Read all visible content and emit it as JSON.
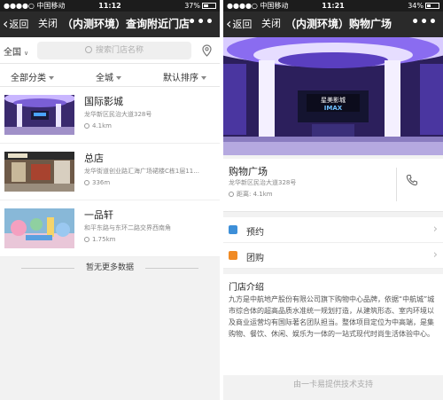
{
  "left": {
    "status": {
      "carrier": "●●●●○ 中国移动",
      "time": "11:12",
      "battery": "37%"
    },
    "nav": {
      "back": "返回",
      "close": "关闭",
      "title": "（内测环境）查询附近门店",
      "more": "•••"
    },
    "search": {
      "city": "全国",
      "placeholder": "搜索门店名称"
    },
    "filters": {
      "category": "全部分类",
      "area": "全城",
      "sort": "默认排序"
    },
    "stores": [
      {
        "name": "国际影城",
        "address": "龙华新区民治大道328号",
        "distance": "4.1km"
      },
      {
        "name": "总店",
        "address": "龙华街道创业路汇海广场裙楼C栋1层11...",
        "distance": "336m"
      },
      {
        "name": "一品轩",
        "address": "和平东路与东环二路交界西南角",
        "distance": "1.75km"
      }
    ],
    "no_more": "暂无更多数据"
  },
  "right": {
    "status": {
      "carrier": "●●●●○ 中国移动",
      "time": "11:21",
      "battery": "34%"
    },
    "nav": {
      "back": "返回",
      "close": "关闭",
      "title": "（内测环境）购物广场",
      "more": "•••"
    },
    "hero": {
      "sign_line1": "星美影城",
      "sign_line2": "IMAX"
    },
    "store": {
      "name": "购物广场",
      "address": "龙华新区民治大道328号",
      "distance": "距离: 4.1km"
    },
    "menu": [
      {
        "label": "预约",
        "color": "#3d8fd8"
      },
      {
        "label": "团购",
        "color": "#f08a24"
      }
    ],
    "intro": {
      "title": "门店介绍",
      "body": "九方是中航地产股份有限公司旗下购物中心品牌，依据“中航城”城市综合体的超高品质水准统一规划打造，从建筑形态、室内环境以及商业运营均有国际著名团队担当。整体项目定位为中高端，是集购物、餐饮、休闲、娱乐为一体的一站式现代时尚生活体验中心。"
    },
    "footer": "由一卡易提供技术支持"
  },
  "colors": {
    "navbar": "#2a2a2a",
    "statusbar": "#1c1c1c",
    "background": "#f2f2f2"
  }
}
